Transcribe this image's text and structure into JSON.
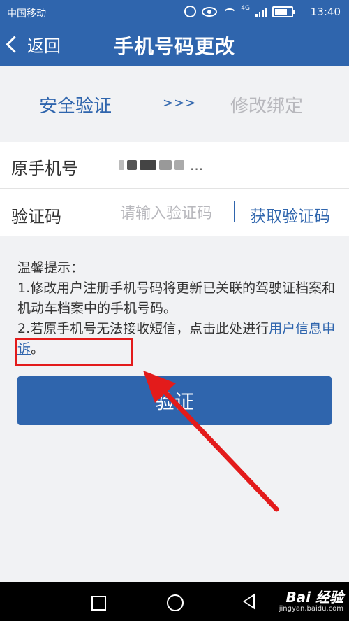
{
  "status_bar": {
    "carrier": "中国移动",
    "network": "4G",
    "time": "13:40"
  },
  "header": {
    "back_label": "返回",
    "title": "手机号码更改"
  },
  "steps": {
    "step1": "安全验证",
    "separator": ">>>",
    "step2": "修改绑定"
  },
  "form": {
    "original_phone_label": "原手机号",
    "original_phone_value_masked": "...",
    "code_label": "验证码",
    "code_placeholder": "请输入验证码",
    "code_value": "",
    "get_code_button": "获取验证码"
  },
  "tips": {
    "heading": "温馨提示：",
    "line1": "1.修改用户注册手机号码将更新已关联的驾驶证档案和机动车档案中的手机号码。",
    "line2_prefix": "2.若原手机号无法接收短信，点击此处进行",
    "line2_link": "用户信息申诉",
    "line2_suffix": "。"
  },
  "verify_button": "验证",
  "watermark": {
    "brand": "Bai 经验",
    "url": "jingyan.baidu.com"
  },
  "colors": {
    "primary": "#2f65ad",
    "background": "#f1f2f4",
    "inactive_step": "#b8b8bd",
    "annotation": "#e31b1b"
  }
}
